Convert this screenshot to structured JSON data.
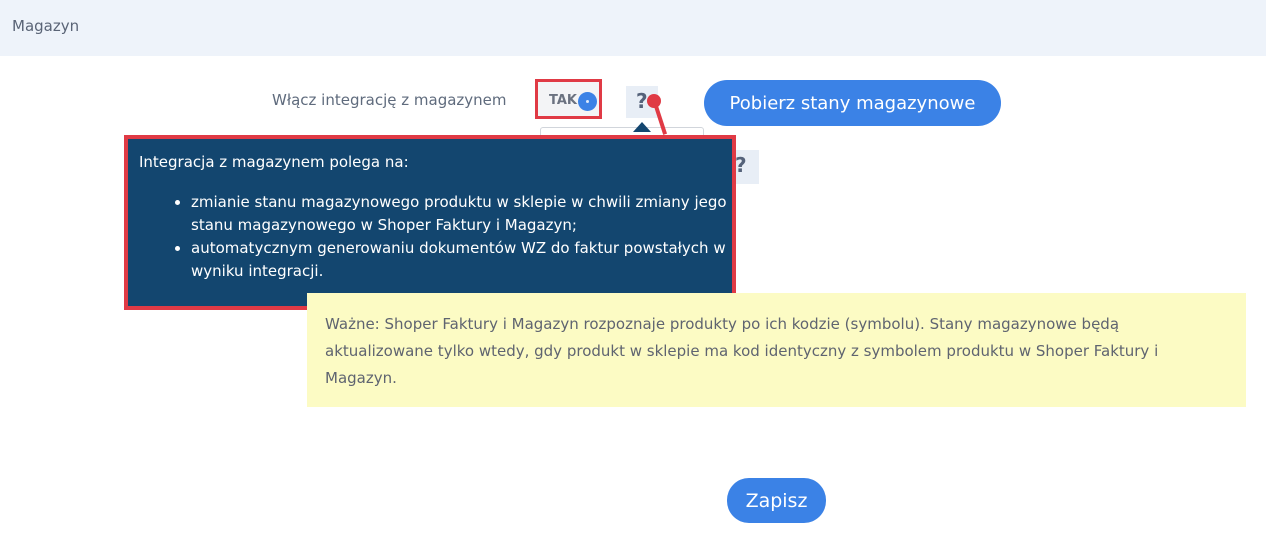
{
  "header": {
    "title": "Magazyn"
  },
  "integration": {
    "label": "Włącz integrację z magazynem",
    "toggle_value": "TAK",
    "help_icon": "?"
  },
  "second_help_icon": "?",
  "fetch_button_label": "Pobierz stany magazynowe",
  "tooltip": {
    "intro": "Integracja z magazynem polega na:",
    "items": [
      "zmianie stanu magazynowego produktu w sklepie w chwili zmiany jego stanu magazynowego w Shoper Faktury i Magazyn;",
      "automatycznym generowaniu dokumentów WZ do faktur powstałych w wyniku integracji."
    ]
  },
  "notice": {
    "text": "Ważne: Shoper Faktury i Magazyn rozpoznaje produkty po ich kodzie (symbolu). Stany magazynowe będą aktualizowane tylko wtedy, gdy produkt w sklepie ma kod identyczny z symbolem produktu w Shoper Faktury i Magazyn."
  },
  "save_button_label": "Zapisz",
  "colors": {
    "accent": "#3b82e6",
    "tooltip_bg": "#13466f",
    "highlight": "#e03a45",
    "notice_bg": "#fcfbc4",
    "header_bg": "#eef3fa"
  }
}
